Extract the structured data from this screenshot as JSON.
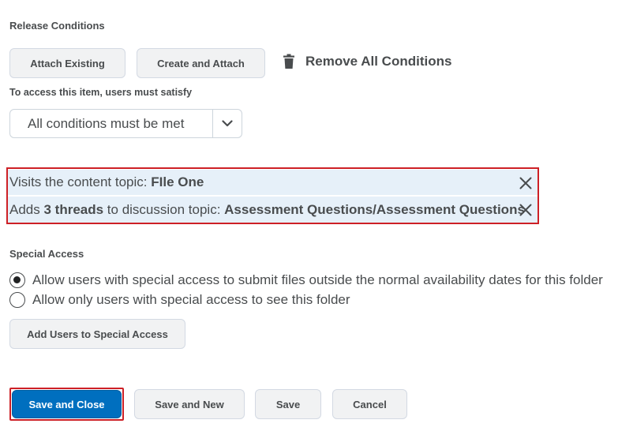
{
  "release_conditions": {
    "label": "Release Conditions",
    "attach_existing": "Attach Existing",
    "create_and_attach": "Create and Attach",
    "remove_all": "Remove All Conditions"
  },
  "access": {
    "label": "To access this item, users must satisfy",
    "selected": "All conditions must be met"
  },
  "conditions": [
    {
      "prefix": "Visits the content topic: ",
      "bold1": "FIle One",
      "middle": "",
      "bold2": ""
    },
    {
      "prefix": "Adds ",
      "bold1": "3 threads",
      "middle": " to discussion topic: ",
      "bold2": "Assessment Questions/Assessment Questions"
    }
  ],
  "special_access": {
    "label": "Special Access",
    "option_outside_dates": "Allow users with special access to submit files outside the normal availability dates for this folder",
    "option_only_special": "Allow only users with special access to see this folder",
    "selected": "outside_dates",
    "add_users": "Add Users to Special Access"
  },
  "footer": {
    "save_close": "Save and Close",
    "save_new": "Save and New",
    "save": "Save",
    "cancel": "Cancel"
  },
  "colors": {
    "primary": "#006fbf",
    "highlight_border": "#cd2026",
    "condition_bg": "#e6f0f9"
  }
}
